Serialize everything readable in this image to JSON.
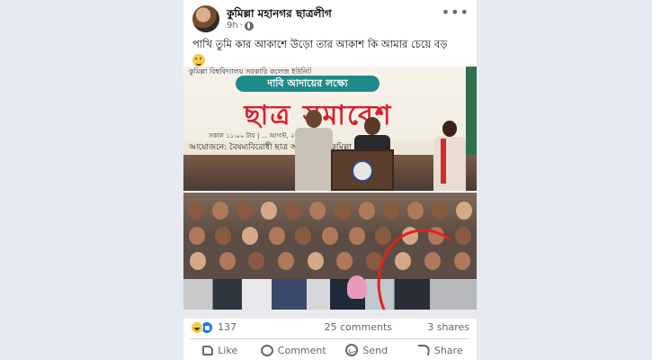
{
  "post": {
    "page_name": "কুমিল্লা মহানগর ছাত্রলীগ",
    "time": "9h",
    "more_label": "•••",
    "caption": "পাখি তুমি কার আকাশে উড়ো তার আকাশ কি আমার চেয়ে বড়"
  },
  "photo1": {
    "banner_top": "কুমিল্লা বিশ্ববিদ্যালয় সরকারি কলেজ ইউনিট",
    "pill": "দাবি আদায়ের লক্ষ্যে",
    "big": "ছাত্র সমাবেশ",
    "time_line": "সকাল ১১:০০ টায় | ... আগস্ট, ২০২৪ (রবিবার)",
    "org": "আয়োজনে: বৈষম্যবিরোধী ছাত্র আন্দোলন - কুমিল্লা"
  },
  "reactions": {
    "count": "137",
    "comments": "25 comments",
    "shares": "3 shares"
  },
  "actions": {
    "like": "Like",
    "comment": "Comment",
    "send": "Send",
    "share": "Share"
  },
  "colors": {
    "accent": "#1877f2",
    "banner_red": "#d7212e",
    "banner_teal": "#1f8a8a",
    "highlight_circle": "#e0231c"
  },
  "icons": [
    "globe-icon",
    "more-icon",
    "haha-reaction-icon",
    "like-reaction-icon",
    "like-icon",
    "comment-icon",
    "send-icon",
    "share-icon"
  ]
}
